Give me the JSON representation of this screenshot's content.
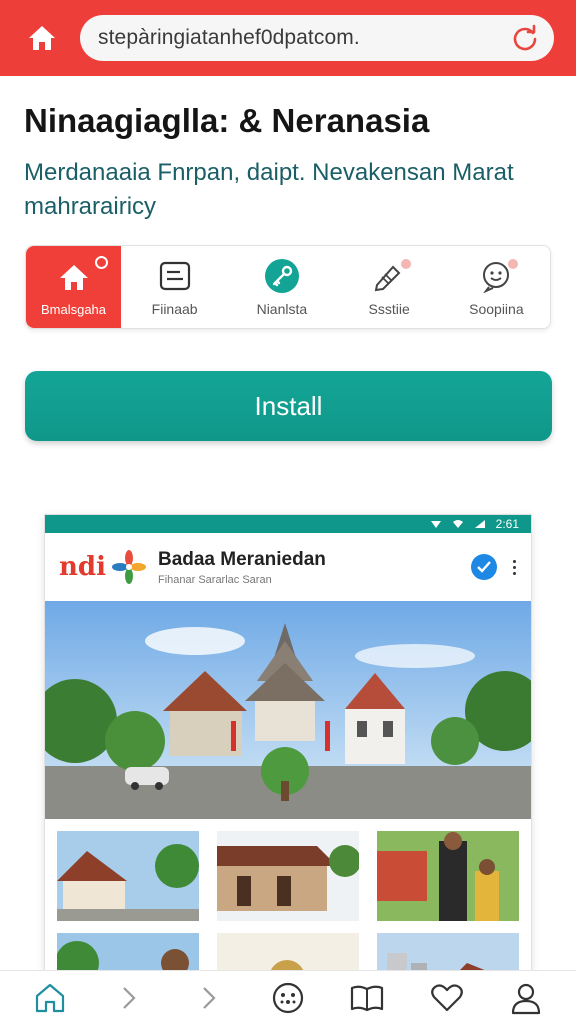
{
  "browser": {
    "url": "stepàringiatanhef0dpatcom.",
    "icons": {
      "home": "home-icon",
      "reload": "reload-icon"
    }
  },
  "header": {
    "title": "Ninaagiaglla: & Neranasia",
    "subtitle": "Merdanaaia Fnrpan, daipt. Nevakensan Marat mahrarairicy"
  },
  "categories": [
    {
      "label": "Bmalsgaha",
      "icon": "home-icon",
      "active": true
    },
    {
      "label": "Fiinaab",
      "icon": "card-icon",
      "active": false
    },
    {
      "label": "Nianlsta",
      "icon": "key-badge-icon",
      "active": false
    },
    {
      "label": "Ssstiie",
      "icon": "pencil-tag-icon",
      "active": false
    },
    {
      "label": "Soopiina",
      "icon": "chat-face-icon",
      "active": false
    }
  ],
  "install": {
    "label": "Install"
  },
  "preview": {
    "status_time": "2:61",
    "app_name": "Badaa Meraniedan",
    "app_subtitle": "Fihanar Sararlac Saran",
    "logo_text": "ndi"
  },
  "colors": {
    "brand_red": "#ee3e3a",
    "accent_teal": "#12a091",
    "subtitle_teal": "#1b5f66",
    "verified_blue": "#1e88e5"
  },
  "bottom_nav": [
    {
      "icon": "home-outline-icon"
    },
    {
      "icon": "chevron-right-icon"
    },
    {
      "icon": "chevron-right-icon"
    },
    {
      "icon": "smiley-icon"
    },
    {
      "icon": "book-icon"
    },
    {
      "icon": "heart-icon"
    },
    {
      "icon": "person-icon"
    }
  ]
}
